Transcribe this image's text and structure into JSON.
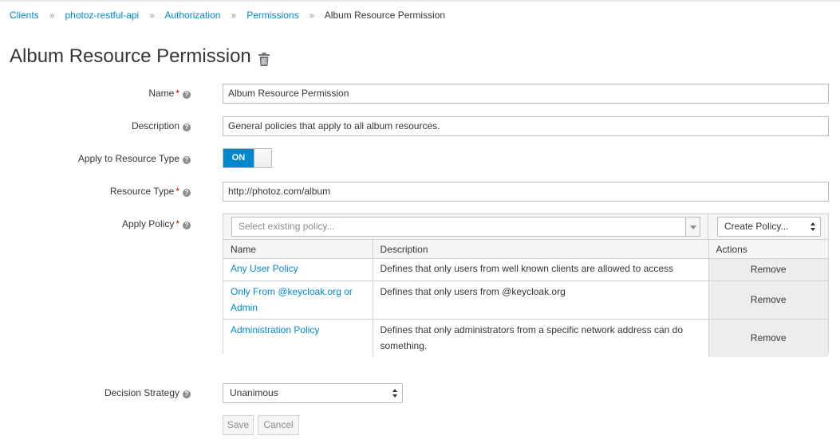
{
  "breadcrumb": {
    "items": [
      "Clients",
      "photoz-restful-api",
      "Authorization",
      "Permissions"
    ],
    "current": "Album Resource Permission",
    "separator": "»"
  },
  "page": {
    "title": "Album Resource Permission",
    "delete_icon": "trash-icon"
  },
  "form": {
    "name": {
      "label": "Name",
      "value": "Album Resource Permission",
      "required": true
    },
    "description": {
      "label": "Description",
      "value": "General policies that apply to all album resources."
    },
    "apply_resource_type": {
      "label": "Apply to Resource Type",
      "toggle_label": "ON",
      "state": true
    },
    "resource_type": {
      "label": "Resource Type",
      "value": "http://photoz.com/album",
      "required": true
    },
    "apply_policy": {
      "label": "Apply Policy",
      "required": true,
      "select_placeholder": "Select existing policy...",
      "create_button": "Create Policy...",
      "columns": [
        "Name",
        "Description",
        "Actions"
      ],
      "rows": [
        {
          "name": "Any User Policy",
          "description": "Defines that only users from well known clients are allowed to access",
          "action": "Remove"
        },
        {
          "name": "Only From @keycloak.org or Admin",
          "description": "Defines that only users from @keycloak.org",
          "action": "Remove"
        },
        {
          "name": "Administration Policy",
          "description": "Defines that only administrators from a specific network address can do something.",
          "action": "Remove"
        }
      ]
    },
    "decision_strategy": {
      "label": "Decision Strategy",
      "value": "Unanimous"
    }
  },
  "buttons": {
    "save": "Save",
    "cancel": "Cancel"
  },
  "colors": {
    "link": "#0088ce",
    "toggle_on": "#0088ce",
    "required": "#cc0000"
  }
}
